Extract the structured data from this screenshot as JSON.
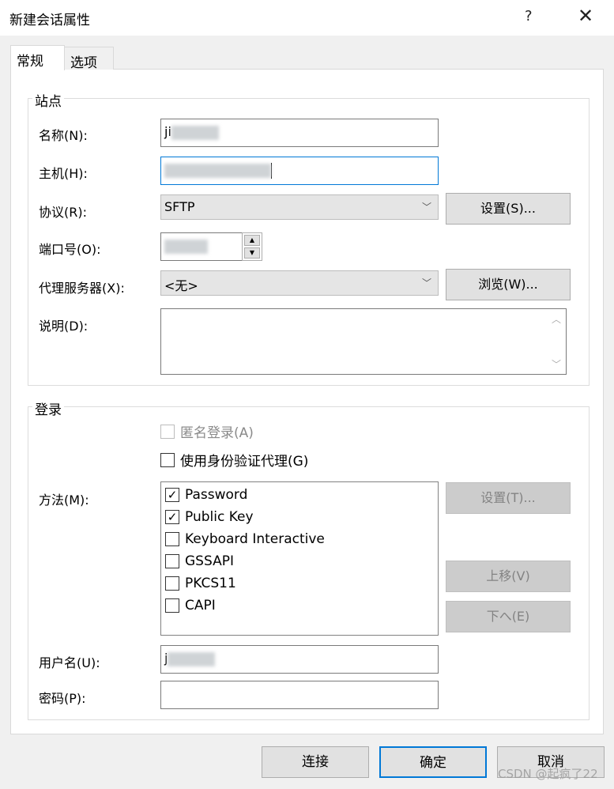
{
  "window": {
    "title": "新建会话属性",
    "help": "?",
    "close": "✕"
  },
  "tabs": [
    {
      "label": "常规"
    },
    {
      "label": "选项"
    }
  ],
  "site": {
    "group_label": "站点",
    "name": {
      "label": "名称(N):",
      "value": "ji"
    },
    "host": {
      "label": "主机(H):",
      "value": ""
    },
    "protocol": {
      "label": "协议(R):",
      "value": "SFTP",
      "settings_button": "设置(S)..."
    },
    "port": {
      "label": "端口号(O):",
      "value": ""
    },
    "proxy": {
      "label": "代理服务器(X):",
      "value": "<无>",
      "browse_button": "浏览(W)..."
    },
    "description": {
      "label": "说明(D):",
      "value": ""
    }
  },
  "login": {
    "group_label": "登录",
    "anonymous": {
      "label": "匿名登录(A)",
      "checked": false,
      "disabled": true
    },
    "agent": {
      "label": "使用身份验证代理(G)",
      "checked": false
    },
    "method": {
      "label": "方法(M):",
      "items": [
        {
          "label": "Password",
          "checked": true
        },
        {
          "label": "Public Key",
          "checked": true
        },
        {
          "label": "Keyboard Interactive",
          "checked": false
        },
        {
          "label": "GSSAPI",
          "checked": false
        },
        {
          "label": "PKCS11",
          "checked": false
        },
        {
          "label": "CAPI",
          "checked": false
        }
      ],
      "settings_button": "设置(T)...",
      "up_button": "上移(V)",
      "down_button": "下へ(E)"
    },
    "username": {
      "label": "用户名(U):",
      "value": "j"
    },
    "password": {
      "label": "密码(P):",
      "value": ""
    }
  },
  "footer": {
    "connect": "连接",
    "ok": "确定",
    "cancel": "取消"
  },
  "watermark": "CSDN @起疯了22"
}
